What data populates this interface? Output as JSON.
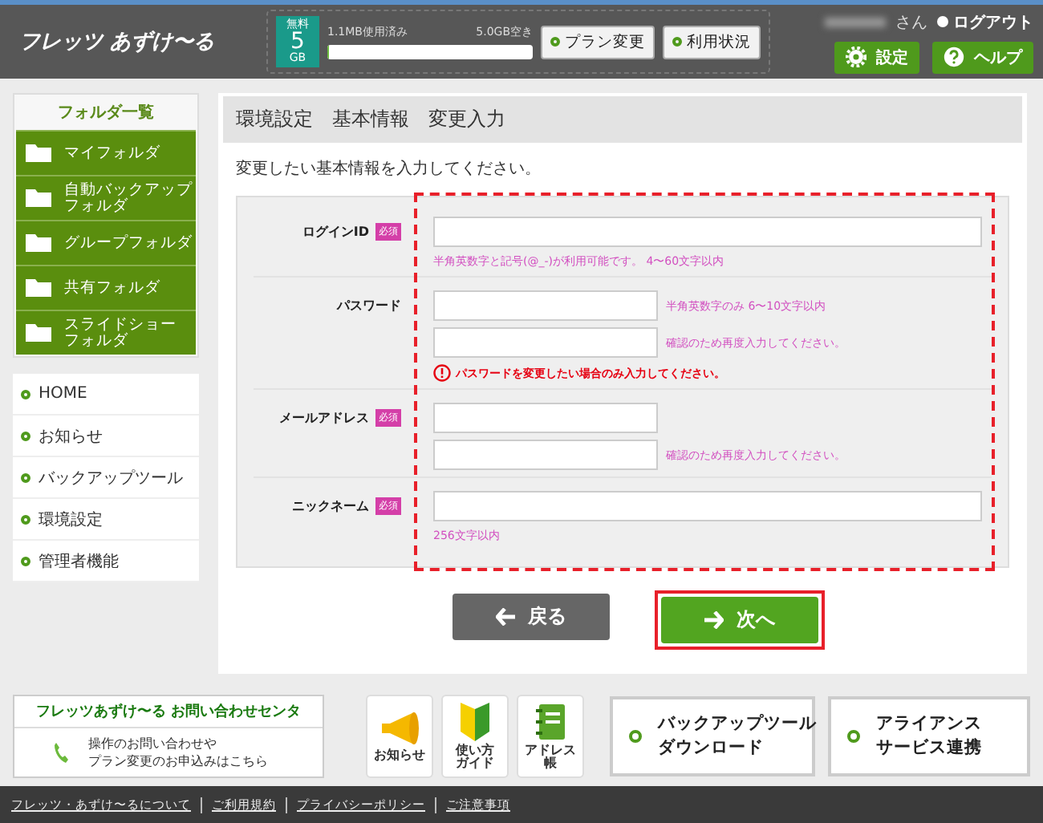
{
  "header": {
    "logo": "フレッツ あずけ〜る",
    "plan": {
      "badge_top": "無料",
      "badge_num": "5",
      "badge_unit": "GB",
      "used": "1.1MB使用済み",
      "free": "5.0GB空き",
      "level": 0.01
    },
    "buttons": [
      "プラン変更",
      "利用状況"
    ],
    "user_suffix": "さん",
    "logout": "ログアウト",
    "settings": "設定",
    "help": "ヘルプ"
  },
  "sidebar": {
    "folder_title": "フォルダ一覧",
    "folders": [
      [
        "マイフォルダ"
      ],
      [
        "自動バックアップ",
        "フォルダ"
      ],
      [
        "グループフォルダ"
      ],
      [
        "共有フォルダ"
      ],
      [
        "スライドショー",
        "フォルダ"
      ]
    ],
    "menu": [
      "HOME",
      "お知らせ",
      "バックアップツール",
      "環境設定",
      "管理者機能"
    ]
  },
  "main": {
    "title": "環境設定　基本情報　変更入力",
    "intro": "変更したい基本情報を入力してください。",
    "fields": [
      {
        "label": "ログインID",
        "required": "必須",
        "inputs": [
          {
            "wide": true
          }
        ],
        "note": "半角英数字と記号(@_-)が利用可能です。 4〜60文字以内"
      },
      {
        "label": "パスワード",
        "inputs": [
          {
            "wide": false,
            "hint": "半角英数字のみ  6〜10文字以内"
          },
          {
            "wide": false,
            "hint": "確認のため再度入力してください。"
          }
        ],
        "warning": "パスワードを変更したい場合のみ入力してください。"
      },
      {
        "label": "メールアドレス",
        "required": "必須",
        "inputs": [
          {
            "wide": false
          },
          {
            "wide": false,
            "hint": "確認のため再度入力してください。"
          }
        ]
      },
      {
        "label": "ニックネーム",
        "required": "必須",
        "inputs": [
          {
            "wide": true
          }
        ],
        "note": "256文字以内"
      }
    ],
    "back": "戻る",
    "next": "次へ"
  },
  "footer": {
    "contact_title": "フレッツあずけ〜る お問い合わせセンタ",
    "contact_lines": [
      "操作のお問い合わせや",
      "プラン変更のお申込みはこちら"
    ],
    "icons": [
      {
        "kind": "megaphone",
        "lines": [
          "お知らせ"
        ]
      },
      {
        "kind": "leaf",
        "lines": [
          "使い方",
          "ガイド"
        ]
      },
      {
        "kind": "notebook",
        "lines": [
          "アドレス",
          "帳"
        ]
      }
    ],
    "big_buttons": [
      [
        "バックアップツール",
        "ダウンロード"
      ],
      [
        "アライアンス",
        "サービス連携"
      ]
    ],
    "links": [
      "フレッツ・あずけ〜るについて",
      "ご利用規約",
      "プライバシーポリシー",
      "ご注意事項"
    ]
  }
}
